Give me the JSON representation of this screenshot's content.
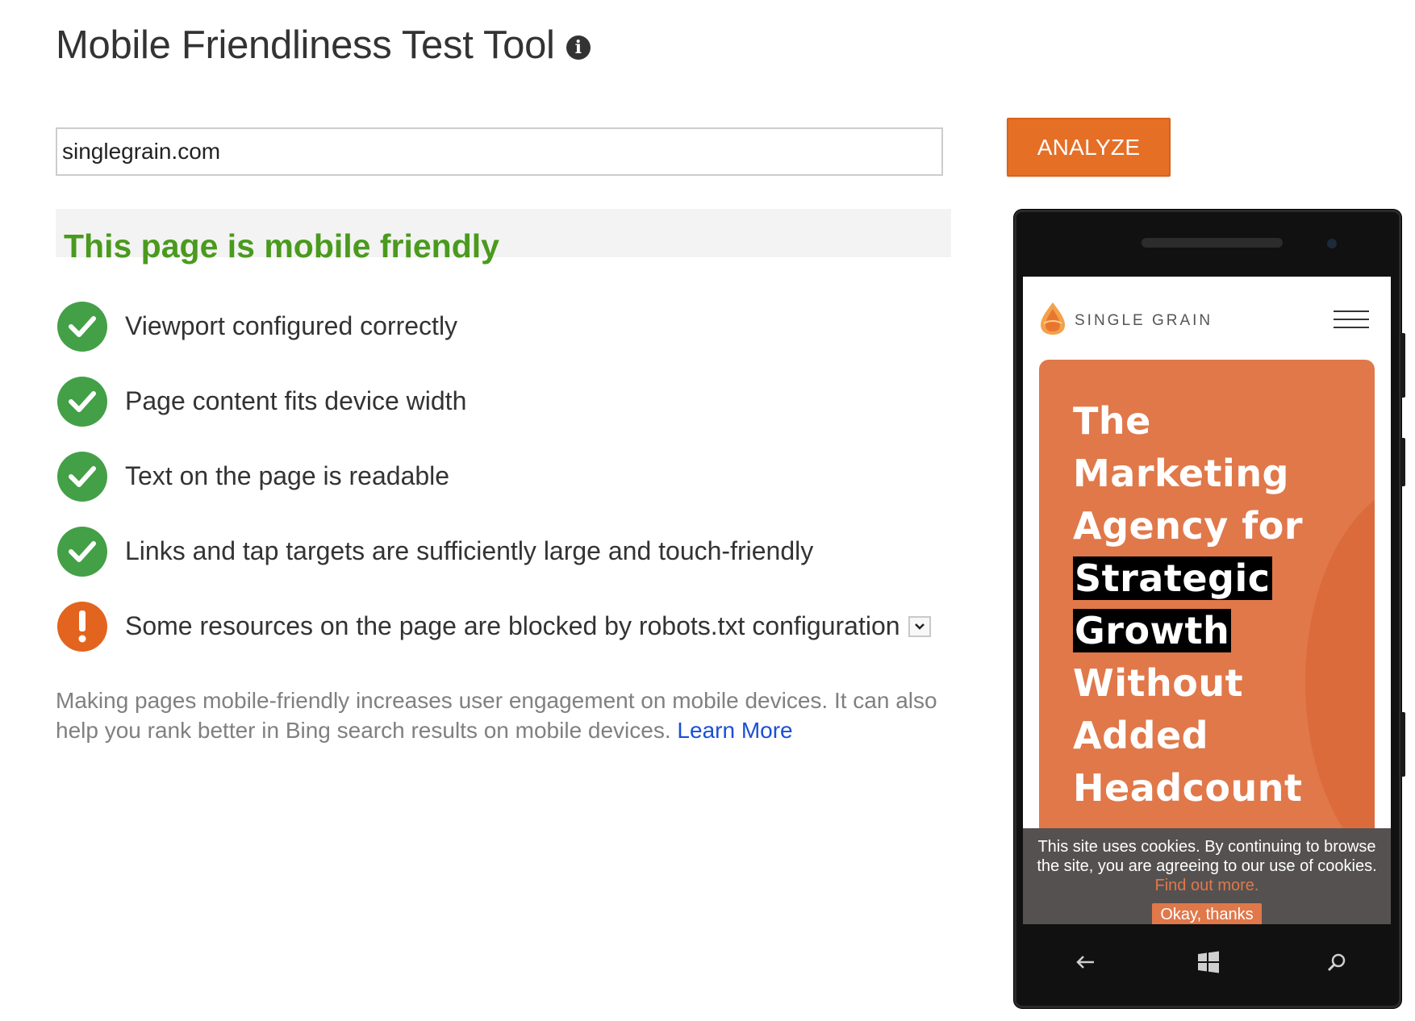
{
  "header": {
    "title": "Mobile Friendliness Test Tool",
    "info_icon": "info-icon"
  },
  "search": {
    "value": "singlegrain.com",
    "analyze_label": "ANALYZE"
  },
  "result": {
    "heading": "This page is mobile friendly",
    "checks": [
      {
        "label": "Viewport configured correctly",
        "status": "pass",
        "icon": "check-icon"
      },
      {
        "label": "Page content fits device width",
        "status": "pass",
        "icon": "check-icon"
      },
      {
        "label": "Text on the page is readable",
        "status": "pass",
        "icon": "check-icon"
      },
      {
        "label": "Links and tap targets are sufficiently large and touch-friendly",
        "status": "pass",
        "icon": "check-icon"
      },
      {
        "label": "Some resources on the page are blocked by robots.txt configuration",
        "status": "warning",
        "icon": "exclamation-icon"
      }
    ],
    "footnote": "Making pages mobile-friendly increases user engagement on mobile devices. It can also help you rank better in Bing search results on mobile devices.",
    "learn_more": "Learn More"
  },
  "phone_preview": {
    "brand": "SINGLE GRAIN",
    "hero_lines": [
      "The",
      "Marketing",
      "Agency for",
      "Strategic",
      "Growth",
      "Without",
      "Added",
      "Headcount"
    ],
    "cookie_text": "This site uses cookies. By continuing to browse the site, you are agreeing to our use of cookies.",
    "cookie_link": "Find out more.",
    "cookie_button": "Okay, thanks"
  },
  "colors": {
    "accent": "#e66f26",
    "success": "#4a9a1d",
    "link": "#1a4fd6"
  }
}
